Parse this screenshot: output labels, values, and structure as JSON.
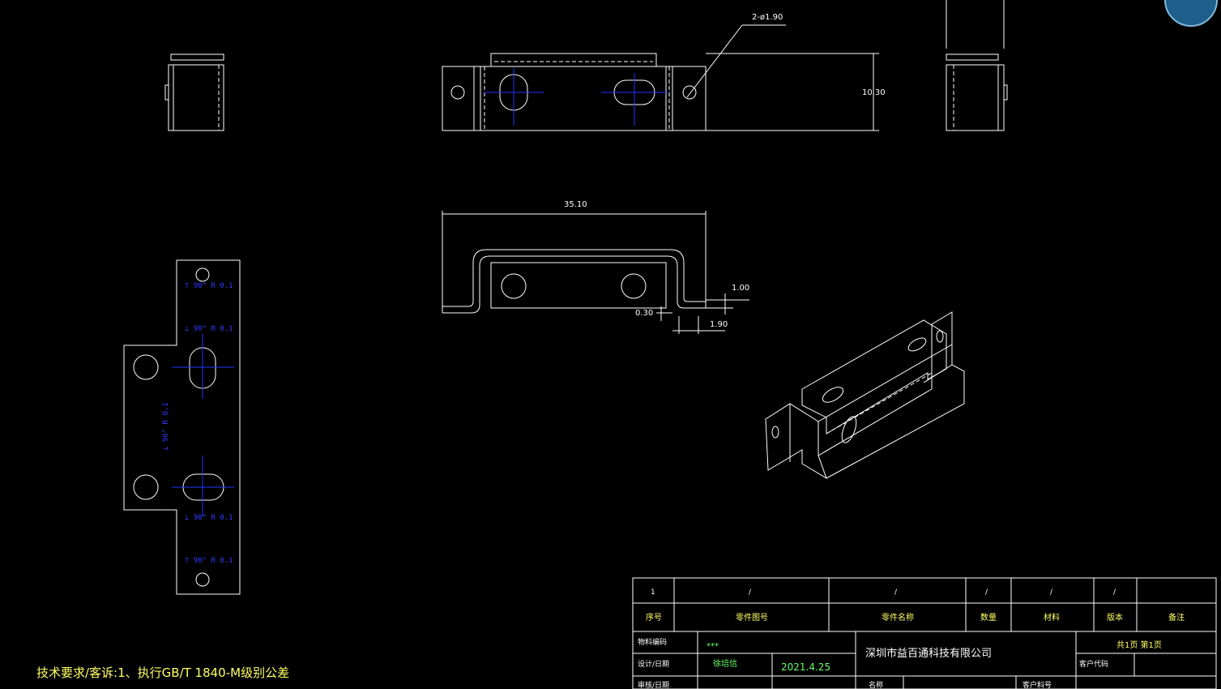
{
  "dimensions": {
    "holes": "2-ø1.90",
    "height": "10.30",
    "width": "35.10",
    "thickness": "1.00",
    "gap": "0.30",
    "flange": "1.90"
  },
  "bend_notes": {
    "top1": "⊤ 90° R 0.1",
    "top2": "⊥ 90° R 0.1",
    "middle": "⊥ 90° R 0.1",
    "bottom1": "⊥ 90° R 0.1",
    "bottom2": "⊤ 90° R 0.1"
  },
  "title_block": {
    "parts_row": [
      "1",
      "/",
      "/",
      "/",
      "/",
      "/"
    ],
    "headers": [
      "序号",
      "零件图号",
      "零件名称",
      "数量",
      "材料",
      "版本",
      "备注"
    ],
    "material_code_label": "物料编码",
    "material_code_value": "***",
    "company": "深圳市益百通科技有限公司",
    "pages": "共1页   第1页",
    "design_label": "设计/日期",
    "designer": "徐培信",
    "date": "2021.4.25",
    "customer_code_label": "客户代码",
    "review_label": "审核/日期",
    "name_label": "名称",
    "customer_material_label": "客户料号"
  },
  "tech_note": "技术要求/客诉:1、执行GB/T 1840-M级别公差",
  "colors": {
    "lines": "#ffffff",
    "centerlines": "#2233ff",
    "title_text": "#ffff66",
    "designer_text": "#66ff66"
  }
}
